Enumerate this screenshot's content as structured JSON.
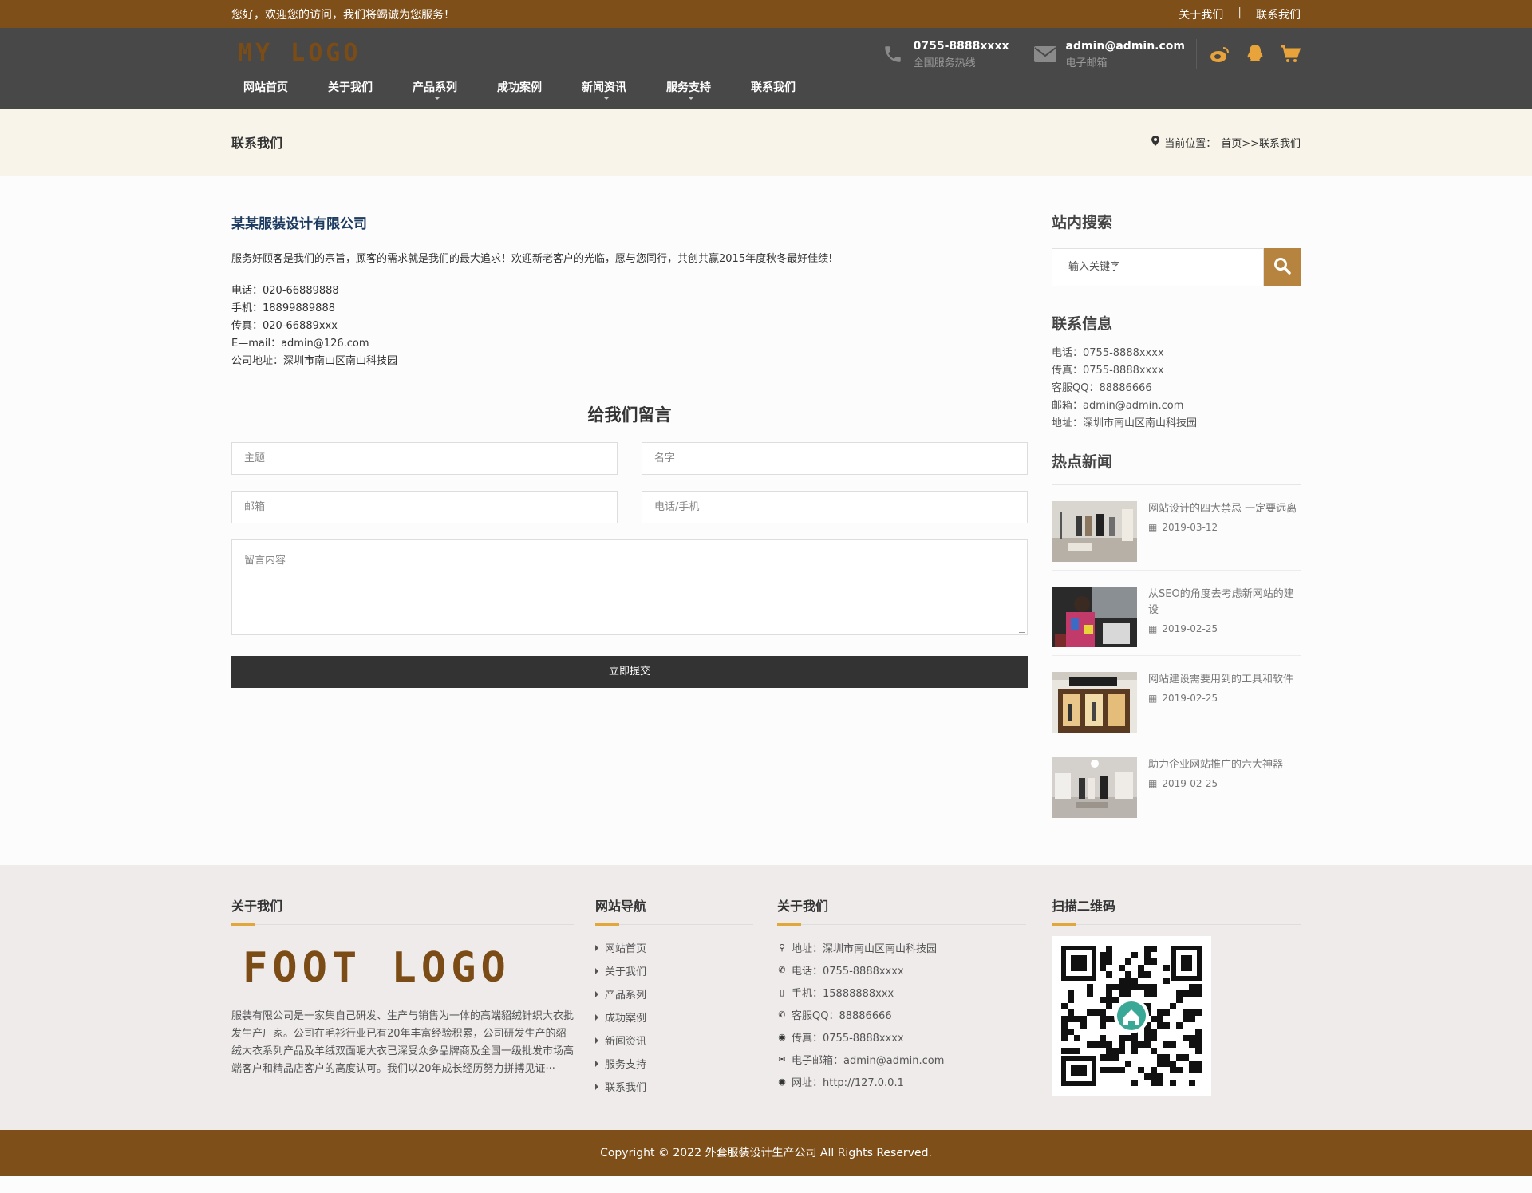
{
  "topbar": {
    "welcome": "您好，欢迎您的访问，我们将竭诚为您服务！",
    "links": [
      "关于我们",
      "|",
      "联系我们"
    ]
  },
  "header": {
    "logo": "MY LOGO",
    "phone": "0755-8888xxxx",
    "phone_label": "全国服务热线",
    "email": "admin@admin.com",
    "email_label": "电子邮箱",
    "social_icons": [
      "weibo-icon",
      "qq-icon",
      "cart-icon"
    ]
  },
  "nav": {
    "items": [
      "网站首页",
      "关于我们",
      "产品系列",
      "成功案例",
      "新闻资讯",
      "服务支持",
      "联系我们"
    ],
    "with_caret": [
      false,
      false,
      true,
      false,
      true,
      true,
      false
    ]
  },
  "band": {
    "title": "联系我们",
    "crumb_prefix": "当前位置：",
    "crumb_path": "首页>>联系我们"
  },
  "content": {
    "company": "某某服装设计有限公司",
    "intro": "服务好顾客是我们的宗旨，顾客的需求就是我们的最大追求！欢迎新老客户的光临，愿与您同行，共创共赢2015年度秋冬最好佳绩!",
    "info": [
      "电话：020-66889888",
      "手机：18899889888",
      "传真：020-66889xxx",
      "E—mail：admin@126.com",
      "公司地址：深圳市南山区南山科技园"
    ],
    "form_title": "给我们留言",
    "fields": {
      "subject": "主题",
      "name": "名字",
      "email": "邮箱",
      "phone": "电话/手机",
      "message": "留言内容"
    },
    "submit": "立即提交"
  },
  "sidebar": {
    "search_title": "站内搜索",
    "search_placeholder": "输入关键字",
    "contact_title": "联系信息",
    "contact": [
      "电话：0755-8888xxxx",
      "传真：0755-8888xxxx",
      "客服QQ：88886666",
      "邮箱：admin@admin.com",
      "地址：深圳市南山区南山科技园"
    ],
    "news_title": "热点新闻",
    "news": [
      {
        "title": "网站设计的四大禁忌 一定要远离",
        "date": "2019-03-12"
      },
      {
        "title": "从SEO的角度去考虑新网站的建设",
        "date": "2019-02-25"
      },
      {
        "title": "网站建设需要用到的工具和软件",
        "date": "2019-02-25"
      },
      {
        "title": "助力企业网站推广的六大神器",
        "date": "2019-02-25"
      }
    ]
  },
  "footer": {
    "about_title": "关于我们",
    "logo": "FOOT LOGO",
    "about_text": "服装有限公司是一家集自己研发、生产与销售为一体的高端貂绒针织大衣批发生产厂家。公司在毛衫行业已有20年丰富经验积累，公司研发生产的貂绒大衣系列产品及羊绒双面呢大衣已深受众多品牌商及全国一级批发市场高端客户和精品店客户的高度认可。我们以20年成长经历努力拼搏见证···",
    "nav_title": "网站导航",
    "nav_links": [
      "网站首页",
      "关于我们",
      "产品系列",
      "成功案例",
      "新闻资讯",
      "服务支持",
      "联系我们"
    ],
    "contact_title": "关于我们",
    "contact": [
      {
        "icon": "map-marker-icon",
        "glyph": "⚲",
        "text": "地址：深圳市南山区南山科技园"
      },
      {
        "icon": "phone-icon",
        "glyph": "✆",
        "text": "电话：0755-8888xxxx"
      },
      {
        "icon": "mobile-icon",
        "glyph": "▯",
        "text": "手机：15888888xxx"
      },
      {
        "icon": "phone-icon",
        "glyph": "✆",
        "text": "客服QQ：88886666"
      },
      {
        "icon": "globe-icon",
        "glyph": "◉",
        "text": "传真：0755-8888xxxx"
      },
      {
        "icon": "envelope-icon",
        "glyph": "✉",
        "text": "电子邮箱：admin@admin.com"
      },
      {
        "icon": "globe-icon",
        "glyph": "◉",
        "text": "网址：http://127.0.0.1"
      }
    ],
    "qr_title": "扫描二维码"
  },
  "copyright": "Copyright © 2022 外套服装设计生产公司 All Rights Reserved.",
  "colors": {
    "brand_brown": "#7f4f19",
    "header_gray": "#484848",
    "accent_gold": "#b6843f",
    "footer_underline": "#e2a73b",
    "company_blue": "#1d3a60"
  }
}
